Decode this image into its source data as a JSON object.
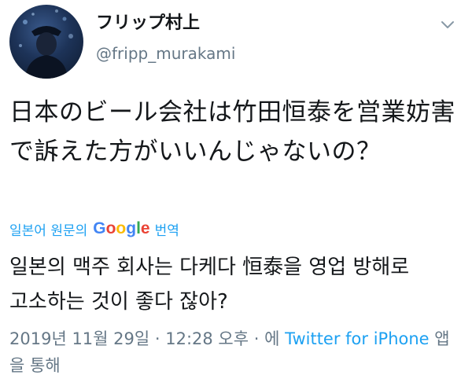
{
  "user": {
    "display_name": "フリップ村上",
    "handle": "@fripp_murakami"
  },
  "tweet": {
    "text": "日本のビール会社は竹田恒泰を営業妨害で訴えた方がいいんじゃないの？"
  },
  "translation": {
    "label_prefix": "일본어 원문의",
    "provider_letters": [
      "G",
      "o",
      "o",
      "g",
      "l",
      "e"
    ],
    "provider_colors": [
      "#4285f4",
      "#ea4335",
      "#fbbc05",
      "#4285f4",
      "#34a853",
      "#ea4335"
    ],
    "label_suffix": "번역",
    "text": "일본의 맥주 회사는 다케다 恒泰을 영업 방해로 고소하는 것이 좋다 잖아?"
  },
  "meta": {
    "timestamp": "2019년 11월 29일 · 12:28 오후",
    "separator": " · 에 ",
    "source": "Twitter for iPhone",
    "suffix": " 앱을 통해"
  },
  "colors": {
    "link": "#1da1f2",
    "secondary_text": "#657786",
    "primary_text": "#14171a"
  },
  "icons": {
    "menu": "chevron-down-icon",
    "avatar": "avatar"
  }
}
